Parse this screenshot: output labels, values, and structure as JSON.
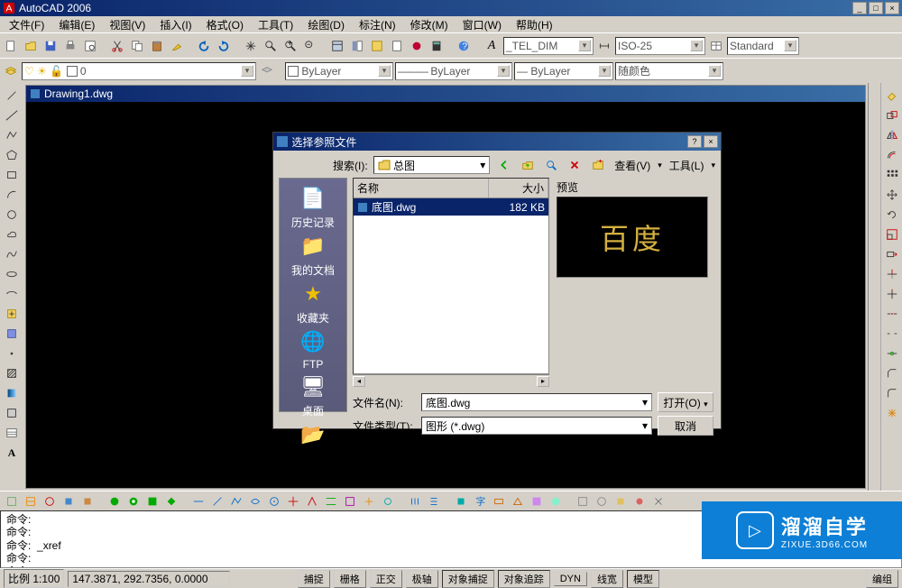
{
  "app": {
    "title": "AutoCAD 2006"
  },
  "menubar": [
    "文件(F)",
    "编辑(E)",
    "视图(V)",
    "插入(I)",
    "格式(O)",
    "工具(T)",
    "绘图(D)",
    "标注(N)",
    "修改(M)",
    "窗口(W)",
    "帮助(H)"
  ],
  "toolbar2": {
    "style_combo1": "_TEL_DIM",
    "style_combo2": "ISO-25",
    "style_combo3": "Standard"
  },
  "layerbar": {
    "layer_combo": "0",
    "linetype1": "ByLayer",
    "linetype2": "ByLayer",
    "linetype3": "ByLayer",
    "color_combo": "随颜色"
  },
  "document": {
    "title": "Drawing1.dwg"
  },
  "dialog": {
    "title": "选择参照文件",
    "search_label": "搜索(I):",
    "search_value": "总图",
    "view_btn": "查看(V)",
    "tools_btn": "工具(L)",
    "preview_label": "预览",
    "preview_text": "百度",
    "col_name": "名称",
    "col_size": "大小",
    "file_name": "底图.dwg",
    "file_size": "182 KB",
    "filename_label": "文件名(N):",
    "filename_value": "底图.dwg",
    "filetype_label": "文件类型(T):",
    "filetype_value": "图形 (*.dwg)",
    "open_btn": "打开(O)",
    "cancel_btn": "取消",
    "places": {
      "history": "历史记录",
      "mydocs": "我的文档",
      "favorites": "收藏夹",
      "ftp": "FTP",
      "desktop": "桌面"
    }
  },
  "command": {
    "prompt": "命令:",
    "xref": "_xref"
  },
  "status": {
    "scale_label": "比例 1:100",
    "coords": "147.3871, 292.7356, 0.0000",
    "snap": "捕捉",
    "grid": "栅格",
    "ortho": "正交",
    "polar": "极轴",
    "osnap": "对象捕捉",
    "otrack": "对象追踪",
    "dyn": "DYN",
    "lwt": "线宽",
    "model": "模型",
    "group": "编组"
  },
  "watermark": {
    "main": "溜溜自学",
    "sub": "ZIXUE.3D66.COM"
  }
}
